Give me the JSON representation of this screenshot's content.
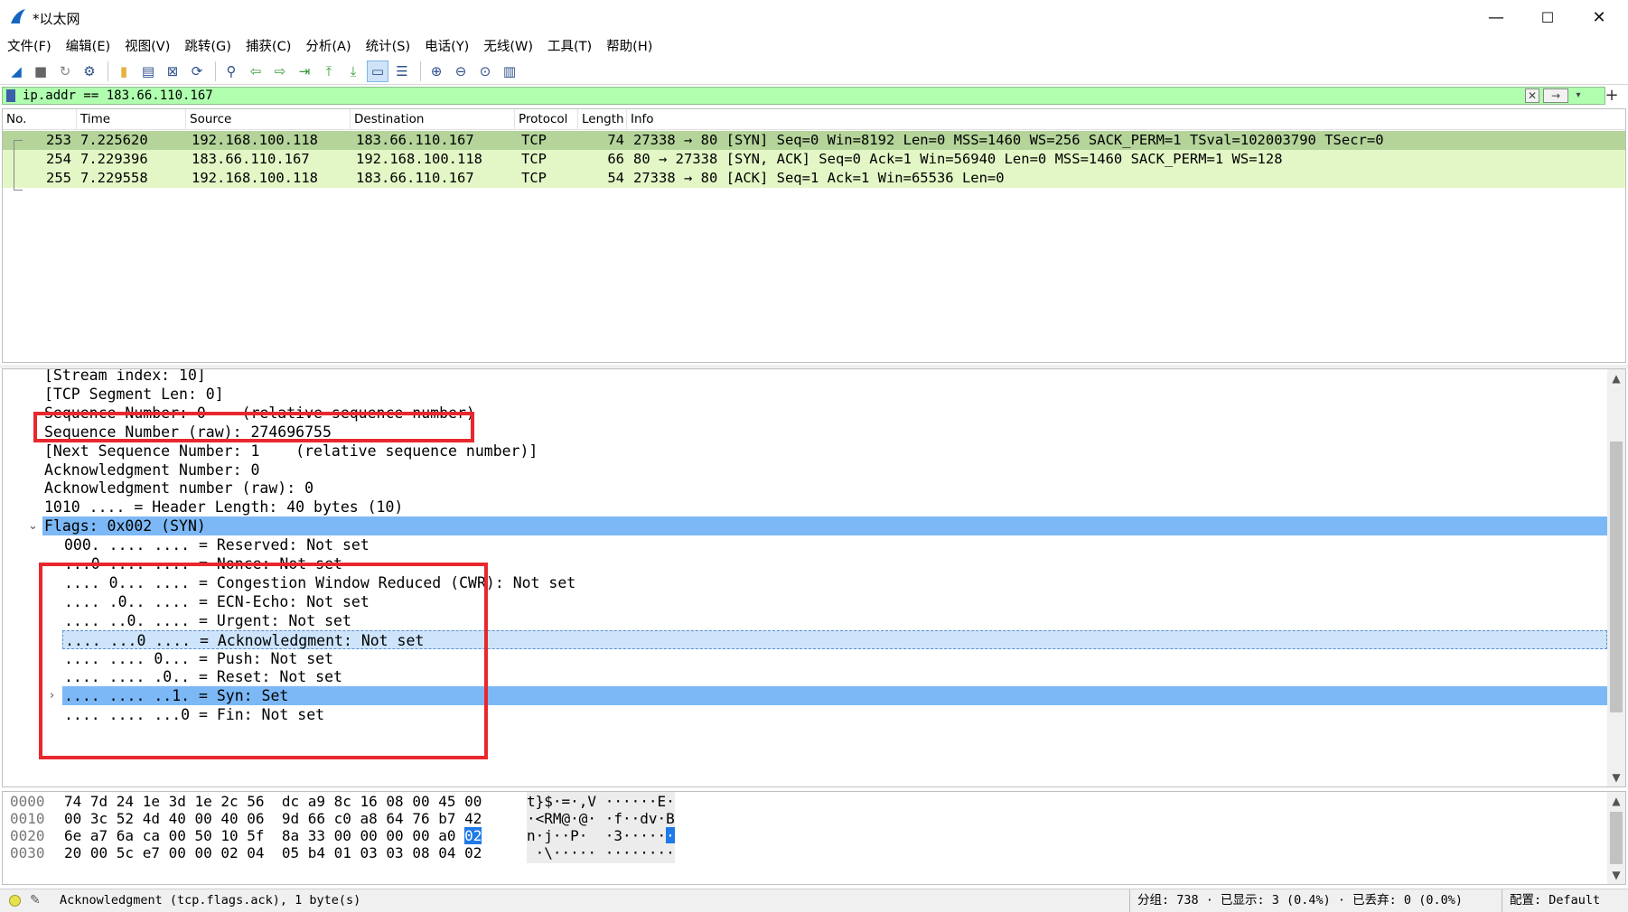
{
  "window": {
    "title": "*以太网",
    "controls": {
      "minimize": "—",
      "maximize": "☐",
      "close": "✕"
    }
  },
  "menu": [
    "文件(F)",
    "编辑(E)",
    "视图(V)",
    "跳转(G)",
    "捕获(C)",
    "分析(A)",
    "统计(S)",
    "电话(Y)",
    "无线(W)",
    "工具(T)",
    "帮助(H)"
  ],
  "toolbar_icons": [
    "shark-fin-start-icon",
    "stop-icon",
    "restart-icon",
    "options-gear-icon",
    "open-folder-icon",
    "save-file-icon",
    "close-file-icon",
    "reload-icon",
    "find-icon",
    "back-arrow-icon",
    "forward-arrow-icon",
    "goto-packet-icon",
    "first-packet-icon",
    "last-packet-icon",
    "autoscroll-icon",
    "colorize-icon",
    "zoom-in-icon",
    "zoom-out-icon",
    "zoom-normal-icon",
    "resize-columns-icon"
  ],
  "filter": {
    "value": "ip.addr == 183.66.110.167",
    "apply": "→",
    "clear": "✕",
    "add": "+"
  },
  "packet_list": {
    "columns": [
      "No.",
      "Time",
      "Source",
      "Destination",
      "Protocol",
      "Length",
      "Info"
    ],
    "rows": [
      {
        "no": "253",
        "time": "7.225620",
        "src": "192.168.100.118",
        "dst": "183.66.110.167",
        "proto": "TCP",
        "len": "74",
        "info": "27338 → 80 [SYN] Seq=0 Win=8192 Len=0 MSS=1460 WS=256 SACK_PERM=1 TSval=102003790 TSecr=0",
        "color": "#b4d49a"
      },
      {
        "no": "254",
        "time": "7.229396",
        "src": "183.66.110.167",
        "dst": "192.168.100.118",
        "proto": "TCP",
        "len": "66",
        "info": "80 → 27338 [SYN, ACK] Seq=0 Ack=1 Win=56940 Len=0 MSS=1460 SACK_PERM=1 WS=128",
        "color": "#e3f7c6"
      },
      {
        "no": "255",
        "time": "7.229558",
        "src": "192.168.100.118",
        "dst": "183.66.110.167",
        "proto": "TCP",
        "len": "54",
        "info": "27338 → 80 [ACK] Seq=1 Ack=1 Win=65536 Len=0",
        "color": "#e3f7c6"
      }
    ]
  },
  "details": [
    {
      "text": "[Stream index: 10]",
      "indent": 1
    },
    {
      "text": "[TCP Segment Len: 0]",
      "indent": 1
    },
    {
      "text": "Sequence Number: 0    (relative sequence number)",
      "indent": 1
    },
    {
      "text": "Sequence Number (raw): 274696755",
      "indent": 1
    },
    {
      "text": "[Next Sequence Number: 1    (relative sequence number)]",
      "indent": 1
    },
    {
      "text": "Acknowledgment Number: 0",
      "indent": 1
    },
    {
      "text": "Acknowledgment number (raw): 0",
      "indent": 1
    },
    {
      "text": "1010 .... = Header Length: 40 bytes (10)",
      "indent": 1
    },
    {
      "text": "Flags: 0x002 (SYN)",
      "indent": 1,
      "highlight": "strong",
      "expander": "⌄"
    },
    {
      "text": "000. .... .... = Reserved: Not set",
      "indent": 2
    },
    {
      "text": "...0 .... .... = Nonce: Not set",
      "indent": 2
    },
    {
      "text": ".... 0... .... = Congestion Window Reduced (CWR): Not set",
      "indent": 2
    },
    {
      "text": ".... .0.. .... = ECN-Echo: Not set",
      "indent": 2
    },
    {
      "text": ".... ..0. .... = Urgent: Not set",
      "indent": 2
    },
    {
      "text": ".... ...0 .... = Acknowledgment: Not set",
      "indent": 2,
      "highlight": "soft"
    },
    {
      "text": ".... .... 0... = Push: Not set",
      "indent": 2
    },
    {
      "text": ".... .... .0.. = Reset: Not set",
      "indent": 2
    },
    {
      "text": ".... .... ..1. = Syn: Set",
      "indent": 2,
      "highlight": "strong",
      "expander": "›"
    },
    {
      "text": ".... .... ...0 = Fin: Not set",
      "indent": 2
    }
  ],
  "bytes": [
    {
      "offset": "0000",
      "hex": "74 7d 24 1e 3d 1e 2c 56  dc a9 8c 16 08 00 45 00",
      "ascii": "t}$·=·,V ······E·"
    },
    {
      "offset": "0010",
      "hex": "00 3c 52 4d 40 00 40 06  9d 66 c0 a8 64 76 b7 42",
      "ascii": "·<RM@·@· ·f··dv·B"
    },
    {
      "offset": "0020",
      "hex": "6e a7 6a ca 00 50 10 5f  8a 33 00 00 00 00 a0 ",
      "hex_sel": "02",
      "ascii": "n·j··P·_ ·3·····",
      "ascii_sel": "·"
    },
    {
      "offset": "0030",
      "hex": "20 00 5c e7 00 00 02 04  05 b4 01 03 03 08 04 02",
      "ascii": " ·\\····· ········"
    }
  ],
  "status": {
    "message": "Acknowledgment (tcp.flags.ack), 1 byte(s)",
    "packets": "分组: 738 · 已显示: 3 (0.4%) · 已丢弃: 0 (0.0%)",
    "profile": "配置: Default"
  }
}
